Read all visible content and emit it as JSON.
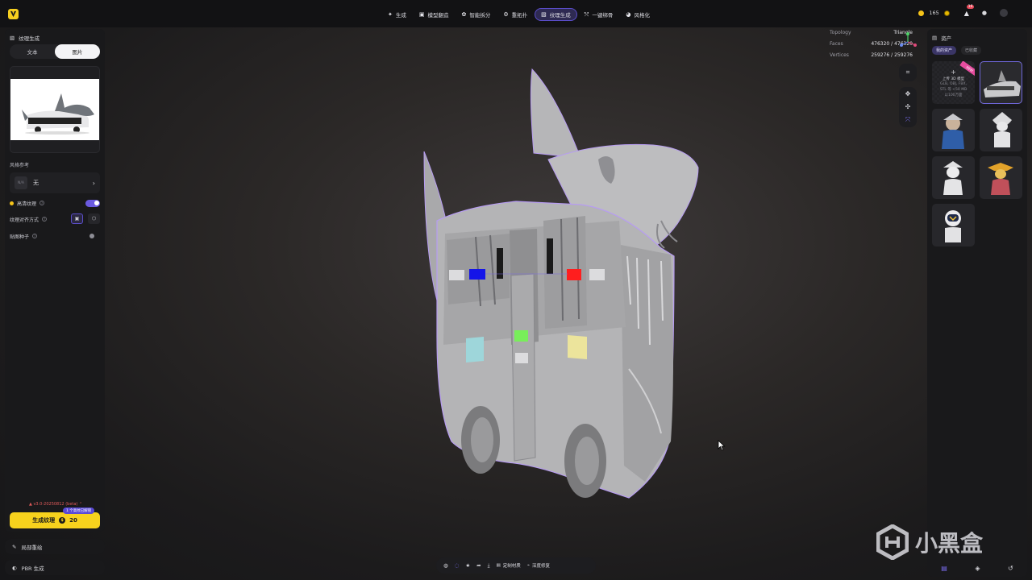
{
  "topbar": {
    "nav": [
      {
        "icon": "✦",
        "label": "生成"
      },
      {
        "icon": "▣",
        "label": "模型翻造"
      },
      {
        "icon": "✿",
        "label": "智能拆分"
      },
      {
        "icon": "⚙",
        "label": "重拓扑"
      },
      {
        "icon": "▧",
        "label": "纹理生成",
        "active": true
      },
      {
        "icon": "⤲",
        "label": "一键绑骨"
      },
      {
        "icon": "◕",
        "label": "风格化"
      }
    ],
    "credits": "165",
    "notification_count": "16"
  },
  "left_panel": {
    "title": "纹理生成",
    "tabs": [
      "文本",
      "图片"
    ],
    "active_tab": "图片",
    "style_ref_label": "风格参考",
    "style_thumb": "N/A",
    "style_value": "无",
    "hd_texture_label": "高清纹理",
    "hd_texture_on": true,
    "texture_align_label": "纹理对齐方式",
    "seed_label": "贴图种子",
    "seed_on": false,
    "version": "v3.0-20250812 (beta)",
    "generate_label": "生成纹理",
    "generate_cost": "20",
    "generate_tag": "1 个高纹已解锁",
    "local_repaint": "局部重绘",
    "pbr_generate": "PBR 生成"
  },
  "viewport": {
    "info": [
      {
        "key": "Topology",
        "value": "Triangle"
      },
      {
        "key": "Faces",
        "value": "476320 / 476320"
      },
      {
        "key": "Vertices",
        "value": "259276 / 259276"
      }
    ],
    "bottom_toolbar": {
      "custom_material": "定制材质",
      "depth_repaint": "深度修复"
    }
  },
  "right_panel": {
    "title": "资产",
    "tabs": [
      "我的资产",
      "已收藏"
    ],
    "upload_label": "上传 3D 模型",
    "upload_hint1": "GLB, OBJ, FBX,",
    "upload_hint2": "STL 等 <50 MB",
    "upload_hint3": "以100万面",
    "new_badge": "NEW"
  },
  "watermark": "小黑盒",
  "colors": {
    "accent": "#6a5ae0",
    "generate": "#f7d21d",
    "badge": "#e94a5a",
    "model": "#b8b8ba",
    "outline": "#b79cf2"
  }
}
